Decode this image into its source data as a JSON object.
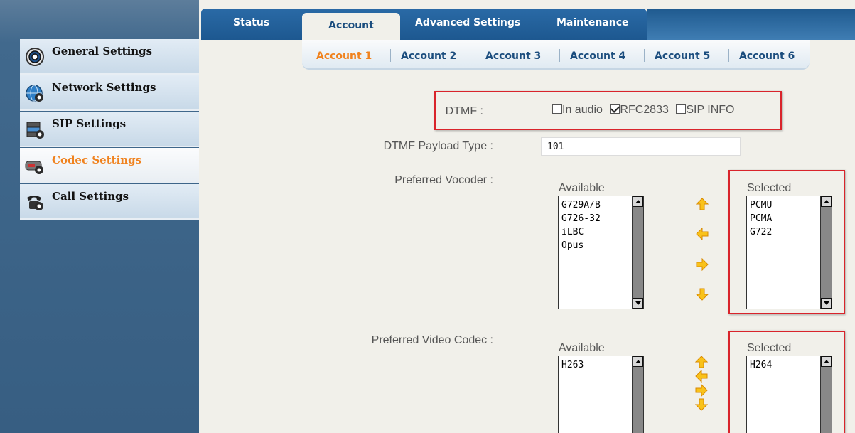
{
  "colors": {
    "accent_orange": "#f0821e",
    "nav_blue": "#1b4d7e",
    "highlight_red": "#d9242b"
  },
  "main_tabs": [
    {
      "label": "Status",
      "active": false
    },
    {
      "label": "Account",
      "active": true
    },
    {
      "label": "Advanced Settings",
      "active": false
    },
    {
      "label": "Maintenance",
      "active": false
    }
  ],
  "account_tabs": [
    {
      "label": "Account 1",
      "active": true
    },
    {
      "label": "Account 2",
      "active": false
    },
    {
      "label": "Account 3",
      "active": false
    },
    {
      "label": "Account 4",
      "active": false
    },
    {
      "label": "Account 5",
      "active": false
    },
    {
      "label": "Account 6",
      "active": false
    }
  ],
  "sidebar": {
    "items": [
      {
        "label": "General Settings",
        "icon": "gear-icon",
        "active": false
      },
      {
        "label": "Network Settings",
        "icon": "globe-gear-icon",
        "active": false
      },
      {
        "label": "SIP Settings",
        "icon": "server-gear-icon",
        "active": false
      },
      {
        "label": "Codec Settings",
        "icon": "codec-gear-icon",
        "active": true
      },
      {
        "label": "Call Settings",
        "icon": "phone-gear-icon",
        "active": false
      }
    ]
  },
  "form": {
    "dtmf": {
      "label": "DTMF :",
      "options": [
        {
          "label": "In audio",
          "checked": false
        },
        {
          "label": "RFC2833",
          "checked": true
        },
        {
          "label": "SIP INFO",
          "checked": false
        }
      ]
    },
    "dtmf_payload_type": {
      "label": "DTMF Payload Type :",
      "value": "101"
    },
    "preferred_vocoder": {
      "label": "Preferred Vocoder :",
      "available_caption": "Available",
      "selected_caption": "Selected",
      "available": [
        "G729A/B",
        "G726-32",
        "iLBC",
        "Opus"
      ],
      "selected": [
        "PCMU",
        "PCMA",
        "G722"
      ]
    },
    "preferred_video_codec": {
      "label": "Preferred Video Codec :",
      "available_caption": "Available",
      "selected_caption": "Selected",
      "available": [
        "H263"
      ],
      "selected": [
        "H264"
      ]
    }
  }
}
